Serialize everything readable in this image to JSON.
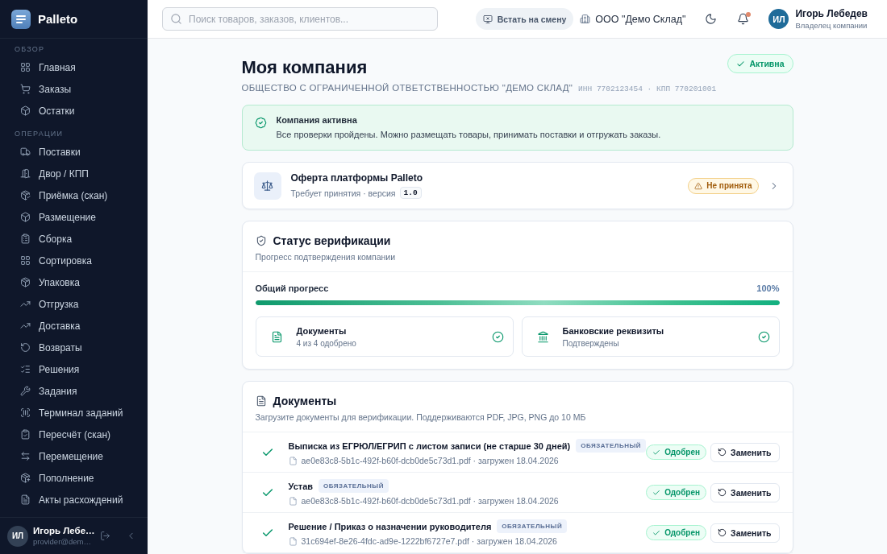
{
  "sidebar": {
    "brand": "Palleto",
    "sections": [
      {
        "title": "ОБЗОР",
        "items": [
          {
            "label": "Главная",
            "selected": false
          },
          {
            "label": "Заказы",
            "selected": false
          },
          {
            "label": "Остатки",
            "selected": false
          }
        ]
      },
      {
        "title": "ОПЕРАЦИИ",
        "items": [
          {
            "label": "Поставки",
            "selected": false
          },
          {
            "label": "Двор / КПП",
            "selected": false
          },
          {
            "label": "Приёмка (скан)",
            "selected": false
          },
          {
            "label": "Размещение",
            "selected": false
          },
          {
            "label": "Сборка",
            "selected": false
          },
          {
            "label": "Сортировка",
            "selected": false
          },
          {
            "label": "Упаковка",
            "selected": false
          },
          {
            "label": "Отгрузка",
            "selected": false
          },
          {
            "label": "Доставка",
            "selected": false
          },
          {
            "label": "Возвраты",
            "selected": false
          },
          {
            "label": "Решения",
            "selected": false
          },
          {
            "label": "Задания",
            "selected": false
          },
          {
            "label": "Терминал заданий",
            "selected": false
          },
          {
            "label": "Пересчёт (скан)",
            "selected": false
          },
          {
            "label": "Перемещение",
            "selected": false
          },
          {
            "label": "Пополнение",
            "selected": false
          },
          {
            "label": "Акты расхождений",
            "selected": false
          }
        ]
      }
    ],
    "user": {
      "initials": "ИЛ",
      "name": "Игорь Лебе…",
      "email": "provider@dem…"
    }
  },
  "header": {
    "search": {
      "placeholder": "Поиск товаров, заказов, клиентов..."
    },
    "shift_button": "Встать на смену",
    "company": "ООО \"Демо Склад\"",
    "notifications": {
      "unread": true
    },
    "user": {
      "initials": "ИЛ",
      "name": "Игорь Лебедев",
      "role": "Владелец компании"
    }
  },
  "page": {
    "title": "Моя компания",
    "status": "Активна",
    "legal_name": "ОБЩЕСТВО С ОГРАНИЧЕННОЙ ОТВЕТСТВЕННОСТЬЮ \"ДЕМО СКЛАД\"",
    "codes": "ИНН 7702123454 · КПП 770201001"
  },
  "alert": {
    "title": "Компания активна",
    "text": "Все проверки пройдены. Можно размещать товары, принимать поставки и отгружать заказы."
  },
  "offer": {
    "title": "Оферта платформы Palleto",
    "subtitle": "Требует принятия · версия",
    "version": "1.0",
    "status": "Не принята"
  },
  "verification": {
    "title": "Статус верификации",
    "subtitle": "Прогресс подтверждения компании",
    "progress": {
      "label": "Общий прогресс",
      "reading": "100%",
      "level": 1
    },
    "items": [
      {
        "title": "Документы",
        "subtitle": "4 из 4 одобрено",
        "done": true
      },
      {
        "title": "Банковские реквизиты",
        "subtitle": "Подтверждены",
        "done": true
      }
    ]
  },
  "documents": {
    "title": "Документы",
    "subtitle": "Загрузите документы для верификации. Поддерживаются PDF, JPG, PNG до 10 МБ",
    "rows": [
      {
        "title": "Выписка из ЕГРЮЛ/ЕГРИП с листом записи (не старше 30 дней)",
        "tag": "ОБЯЗАТЕЛЬНЫЙ",
        "meta": "ae0e83c8-5b1c-492f-b60f-dcb0de5c73d1.pdf · загружен 18.04.2026",
        "approved": true,
        "status": "Одобрен",
        "action": "Заменить"
      },
      {
        "title": "Устав",
        "tag": "ОБЯЗАТЕЛЬНЫЙ",
        "meta": "ae0e83c8-5b1c-492f-b60f-dcb0de5c73d1.pdf · загружен 18.04.2026",
        "approved": true,
        "status": "Одобрен",
        "action": "Заменить"
      },
      {
        "title": "Решение / Приказ о назначении руководителя",
        "tag": "ОБЯЗАТЕЛЬНЫЙ",
        "meta": "31c694ef-8e26-4fdc-ad9e-1222bf6727e7.pdf · загружен 18.04.2026",
        "approved": true,
        "status": "Одобрен",
        "action": "Заменить"
      }
    ]
  }
}
